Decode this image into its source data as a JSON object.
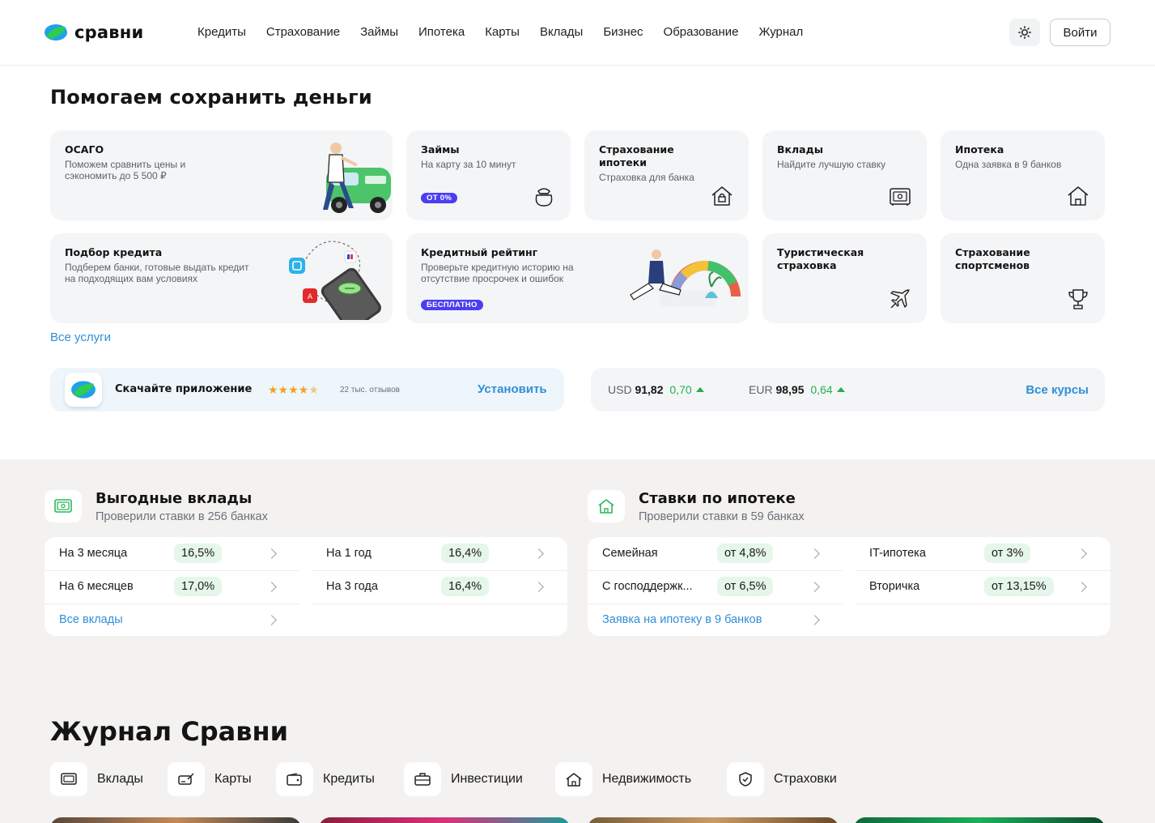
{
  "header": {
    "logo_text": "сравни",
    "nav": [
      "Кредиты",
      "Страхование",
      "Займы",
      "Ипотека",
      "Карты",
      "Вклады",
      "Бизнес",
      "Образование",
      "Журнал"
    ],
    "login_label": "Войти"
  },
  "hero": {
    "title": "Помогаем сохранить деньги",
    "cards": [
      {
        "title": "ОСАГО",
        "sub": "Поможем сравнить цены и сэкономить до 5 500 ₽"
      },
      {
        "title": "Займы",
        "sub": "На карту за 10 минут",
        "badge": "ОТ 0%"
      },
      {
        "title": "Страхование ипотеки",
        "sub": "Страховка для банка"
      },
      {
        "title": "Вклады",
        "sub": "Найдите лучшую ставку"
      },
      {
        "title": "Ипотека",
        "sub": "Одна заявка в 9 банков"
      },
      {
        "title": "Подбор кредита",
        "sub": "Подберем банки, готовые выдать кредит на подходящих вам условиях"
      },
      {
        "title": "Кредитный рейтинг",
        "sub": "Проверьте кредитную историю на отсутствие просрочек и ошибок",
        "badge": "БЕСПЛАТНО"
      },
      {
        "title": "Туристическая страховка",
        "sub": ""
      },
      {
        "title": "Страхование спортсменов",
        "sub": ""
      }
    ],
    "all_services": "Все услуги"
  },
  "app": {
    "text": "Скачайте приложение",
    "rating": 4.5,
    "reviews": "22 тыс. отзывов",
    "install": "Установить"
  },
  "rates": {
    "usd": {
      "label": "USD",
      "value": "91,82",
      "change": "0,70"
    },
    "eur": {
      "label": "EUR",
      "value": "98,95",
      "change": "0,64"
    },
    "all": "Все курсы"
  },
  "deposits": {
    "title": "Выгодные вклады",
    "sub": "Проверили ставки в 256 банках",
    "rows": [
      {
        "label": "На 3 месяца",
        "value": "16,5%"
      },
      {
        "label": "На 1 год",
        "value": "16,4%"
      },
      {
        "label": "На 6 месяцев",
        "value": "17,0%"
      },
      {
        "label": "На 3 года",
        "value": "16,4%"
      }
    ],
    "link": "Все вклады"
  },
  "mortgage": {
    "title": "Ставки по ипотеке",
    "sub": "Проверили ставки в 59 банках",
    "rows": [
      {
        "label": "Семейная",
        "value": "от 4,8%"
      },
      {
        "label": "IT-ипотека",
        "value": "от 3%"
      },
      {
        "label": "С господдержк...",
        "value": "от 6,5%"
      },
      {
        "label": "Вторичка",
        "value": "от 13,15%"
      }
    ],
    "link": "Заявка на ипотеку в 9 банков"
  },
  "journal": {
    "title": "Журнал Сравни",
    "tags": [
      "Вклады",
      "Карты",
      "Кредиты",
      "Инвестиции",
      "Недвижимость",
      "Страховки"
    ]
  }
}
